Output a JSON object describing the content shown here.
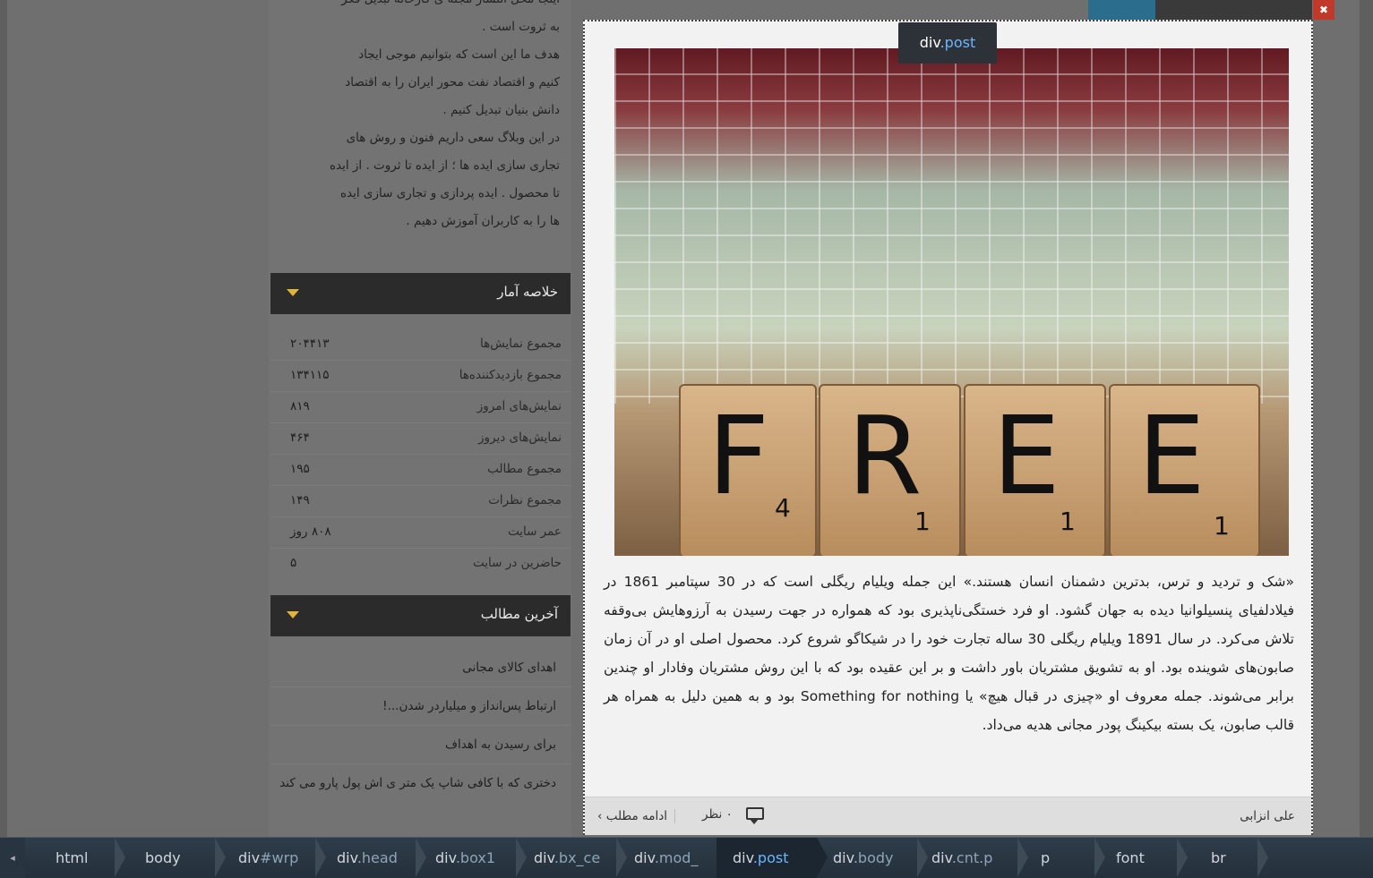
{
  "sidebar": {
    "about_lines": [
      "اینجا محل انتشار مجله ی کارخانه تبدیل فکر",
      "به ثروت است .",
      "هدف ما این است که بتوانیم موجی ایجاد",
      "کنیم و اقتصاد نفت محور ایران را به اقتصاد",
      "دانش بنیان تبدیل کنیم .",
      "در این وبلاگ سعی داریم فنون و روش های",
      "تجاری سازی ایده ها ؛ از ایده تا ثروت . از ایده",
      "تا محصول . ایده پردازی و تجاری سازی ایده",
      "ها را به کاربران آموزش دهیم ."
    ],
    "stats_title": "خلاصه آمار",
    "stats": [
      {
        "label": "مجموع نمایش‌ها",
        "value": "۲۰۴۴۱۳"
      },
      {
        "label": "مجموع بازدیدکننده‌ها",
        "value": "۱۳۴۱۱۵"
      },
      {
        "label": "نمایش‌های امروز",
        "value": "۸۱۹"
      },
      {
        "label": "نمایش‌های دیروز",
        "value": "۴۶۴"
      },
      {
        "label": "مجموع مطالب",
        "value": "۱۹۵"
      },
      {
        "label": "مجموع نظرات",
        "value": "۱۴۹"
      },
      {
        "label": "عمر سایت",
        "value": "۸۰۸ روز"
      },
      {
        "label": "حاضرین در سایت",
        "value": "۵"
      }
    ],
    "latest_title": "آخرین مطالب",
    "latest": [
      "اهدای کالای مجانی",
      "ارتباط پس‌انداز و میلیاردر شدن...!",
      "برای رسیدن به اهداف",
      "دختری که با کافی شاپ یک متر ی اش پول پارو می کند"
    ]
  },
  "post": {
    "tooltip_tag": "div",
    "tooltip_class": ".post",
    "image_letters": [
      {
        "letter": "F",
        "score": "4"
      },
      {
        "letter": "R",
        "score": "1"
      },
      {
        "letter": "E",
        "score": "1"
      },
      {
        "letter": "E",
        "score": "1"
      }
    ],
    "text": "«شک و تردید و ترس، بدترین دشمنان انسان هستند.» این جمله ویلیام ریگلی است که در 30 سپتامبر 1861 در فیلادلفیای پنسیلوانیا دیده به جهان گشود. او فرد خستگی‌ناپذیری بود که همواره در جهت رسیدن به آرزوهایش بی‌وقفه تلاش می‌کرد. در سال 1891 ویلیام ریگلی 30 ساله تجارت خود را در شیکاگو شروع کرد. محصول اصلی او در آن زمان صابون‌های شوینده بود. او به تشویق مشتریان باور داشت و بر این عقیده بود که با این روش مشتریان وفادار او چندین برابر می‌شوند. جمله معروف او «چیزی در قبال هیچ» یا Something for nothing بود و به همین دلیل به همراه هر قالب صابون، یک بسته بیکینگ پودر مجانی هدیه می‌داد.",
    "author": "علی انزابی",
    "comments": "۰ نظر",
    "read_more": "ادامه مطلب ›"
  },
  "breadcrumbs": [
    {
      "tag": "html",
      "cls": ""
    },
    {
      "tag": "body",
      "cls": ""
    },
    {
      "tag": "div",
      "cls": "#wrp"
    },
    {
      "tag": "div",
      "cls": ".head"
    },
    {
      "tag": "div",
      "cls": ".box1"
    },
    {
      "tag": "div",
      "cls": ".bx_ce"
    },
    {
      "tag": "div",
      "cls": ".mod_"
    },
    {
      "tag": "div",
      "cls": ".post"
    },
    {
      "tag": "div",
      "cls": ".body"
    },
    {
      "tag": "div",
      "cls": ".cnt.p"
    },
    {
      "tag": "p",
      "cls": ""
    },
    {
      "tag": "font",
      "cls": ""
    },
    {
      "tag": "br",
      "cls": ""
    }
  ],
  "breadcrumb_left_arrow": "◂",
  "colors": {
    "accent": "#e1b43a",
    "selection": "#6ab6ff"
  }
}
